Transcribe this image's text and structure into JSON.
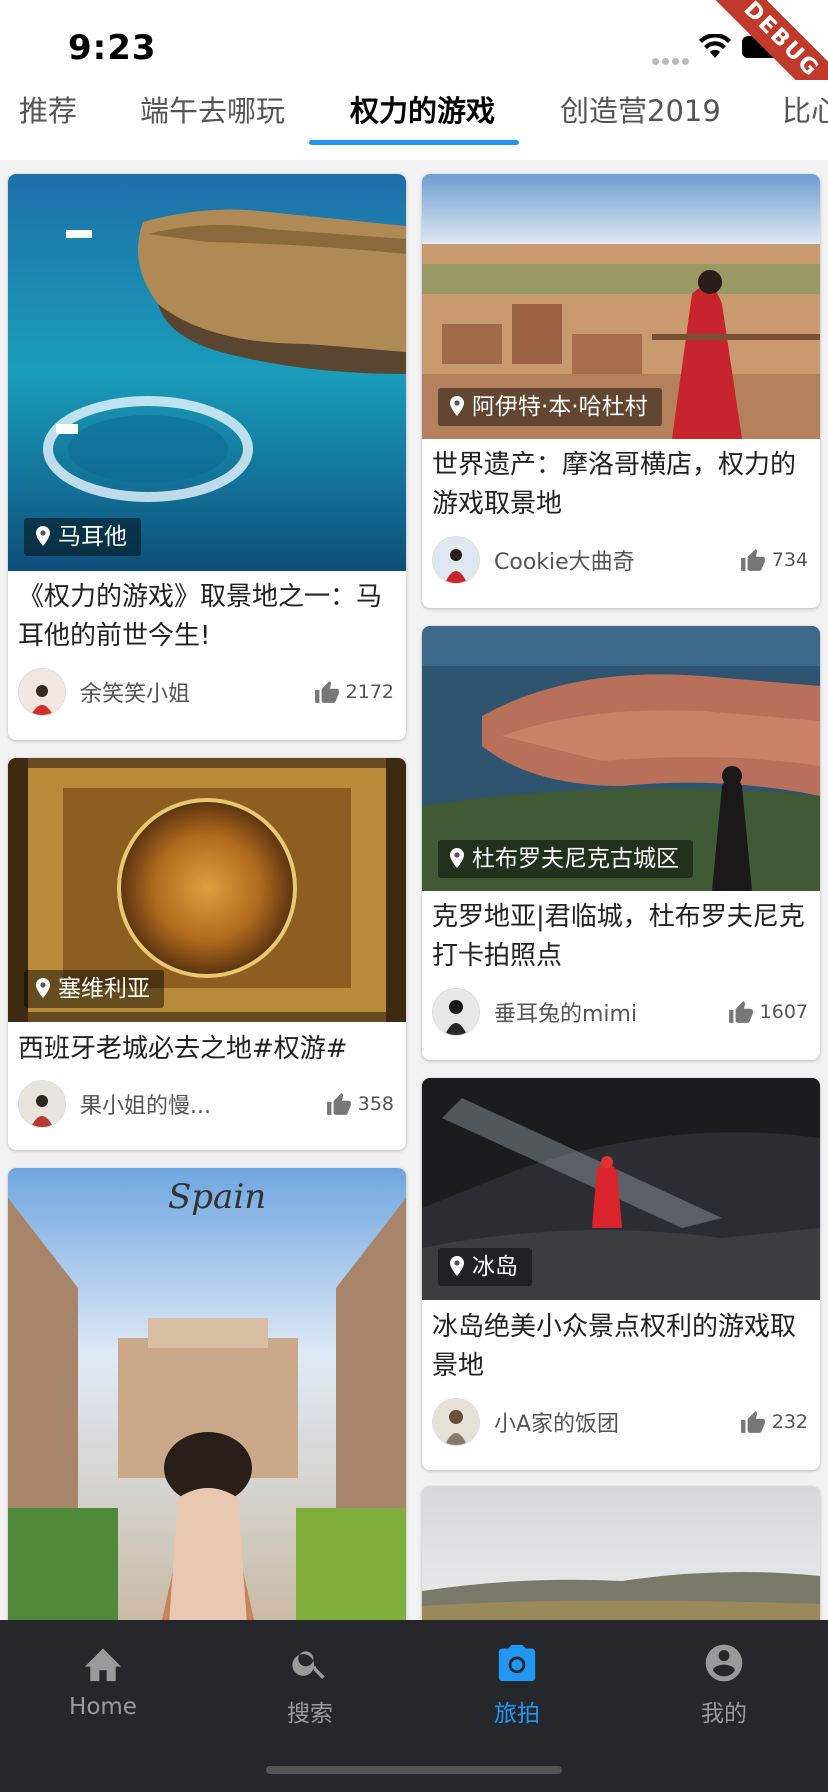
{
  "status_bar": {
    "time": "9:23",
    "debug_label": "DEBUG"
  },
  "tabs": [
    {
      "label": "推荐",
      "active": false
    },
    {
      "label": "端午去哪玩",
      "active": false
    },
    {
      "label": "权力的游戏",
      "active": true
    },
    {
      "label": "创造营2019",
      "active": false
    },
    {
      "label": "比心",
      "active": false
    }
  ],
  "colors": {
    "accent": "#2196f3",
    "nav_bg": "#25272b"
  },
  "cards": [
    {
      "location": "马耳他",
      "title": "《权力的游戏》取景地之一：马耳他的前世今生!",
      "author": "余笑笑小姐",
      "likes": "2172"
    },
    {
      "location": "阿伊特·本·哈杜村",
      "title": "世界遗产：摩洛哥横店，权力的游戏取景地",
      "author": "Cookie大曲奇",
      "likes": "734"
    },
    {
      "location": "塞维利亚",
      "title": "西班牙老城必去之地#权游#",
      "author": "果小姐的慢...",
      "likes": "358"
    },
    {
      "location": "杜布罗夫尼克古城区",
      "title": "克罗地亚|君临城，杜布罗夫尼克打卡拍照点",
      "author": "垂耳兔的mimi",
      "likes": "1607"
    },
    {
      "location": "冰岛",
      "title": "冰岛绝美小众景点权利的游戏取景地",
      "author": "小A家的饭团",
      "likes": "232"
    },
    {
      "photo_text": "Spain"
    }
  ],
  "bottom_nav": [
    {
      "label": "Home",
      "icon": "home-icon",
      "active": false
    },
    {
      "label": "搜索",
      "icon": "search-icon",
      "active": false
    },
    {
      "label": "旅拍",
      "icon": "camera-icon",
      "active": true
    },
    {
      "label": "我的",
      "icon": "account-icon",
      "active": false
    }
  ]
}
